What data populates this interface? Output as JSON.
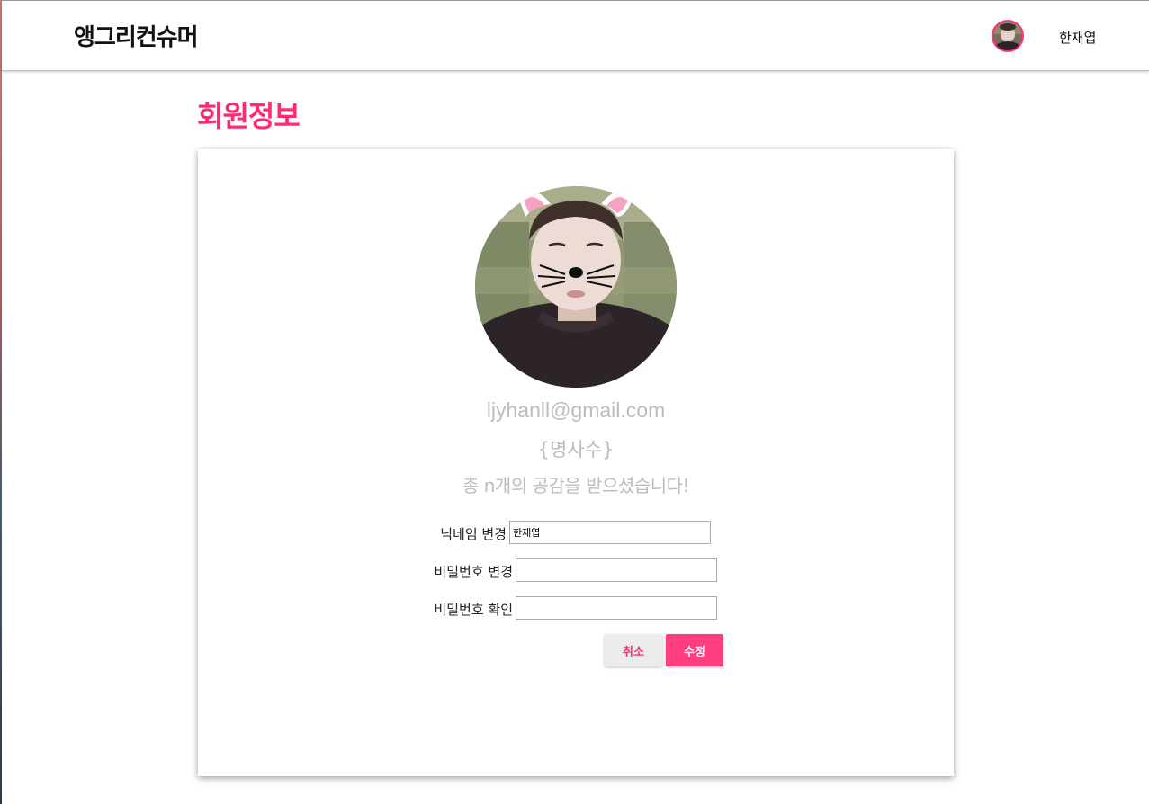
{
  "header": {
    "brand": "앵그리컨슈머",
    "user_name": "한재엽"
  },
  "page": {
    "title": "회원정보"
  },
  "profile": {
    "email": "ljyhanll@gmail.com",
    "cards_count": "{명사수}",
    "likes_text": "총 n개의 공감을 받으셨습니다!"
  },
  "form": {
    "nickname_label": "닉네임 변경",
    "nickname_value": "한재엽",
    "password_label": "비밀번호 변경",
    "password_value": "",
    "password_confirm_label": "비밀번호 확인",
    "password_confirm_value": ""
  },
  "actions": {
    "cancel_label": "취소",
    "submit_label": "수정"
  },
  "colors": {
    "accent": "#ff3d7f",
    "title": "#ff2b6e",
    "muted_text": "#bcbcbc"
  }
}
